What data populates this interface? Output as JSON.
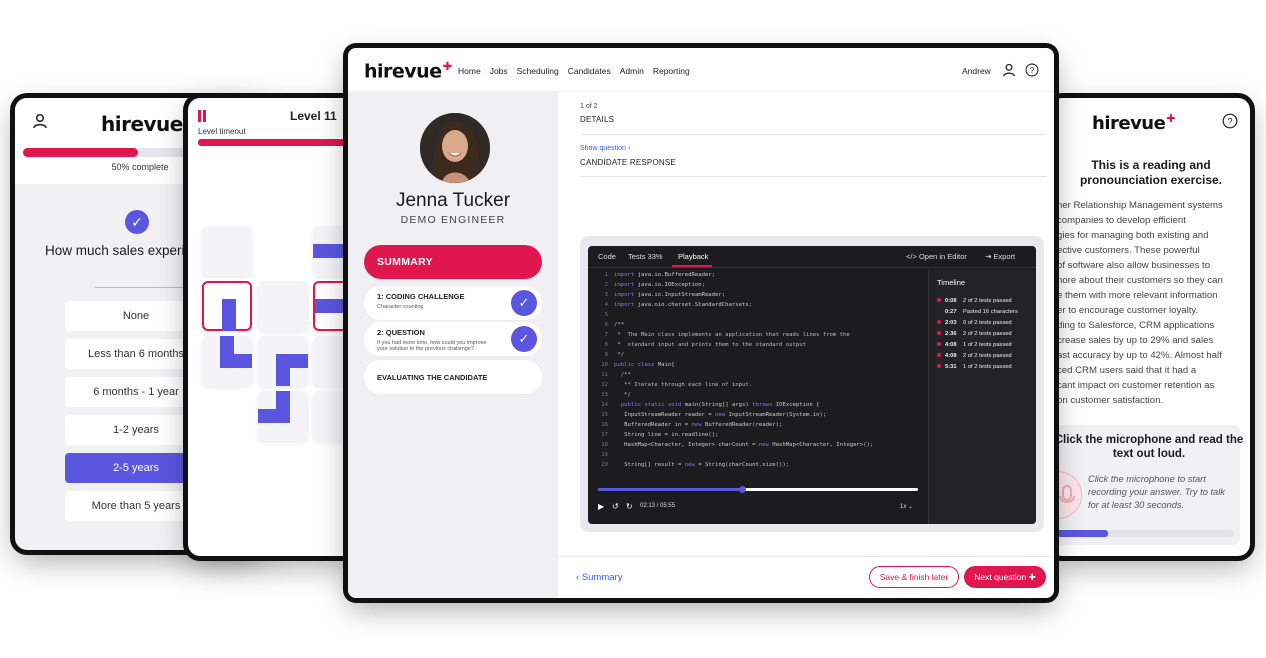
{
  "brand": {
    "logo": "hirevue",
    "accent": "#e0164f",
    "purple": "#5b56e0"
  },
  "survey_card": {
    "progress_percent": 50,
    "progress_label": "50% complete",
    "question": "How much sales experience do you have?",
    "options": [
      "None",
      "Less than 6 months",
      "6 months - 1 year",
      "1-2 years",
      "2-5 years",
      "More than 5 years"
    ],
    "selected_index": 4
  },
  "game_card": {
    "level": "Level 11",
    "timeout_label": "Level timeout"
  },
  "main": {
    "nav": {
      "links": [
        "Home",
        "Jobs",
        "Scheduling",
        "Candidates",
        "Admin",
        "Reporting"
      ],
      "user": "Andrew"
    },
    "candidate": {
      "name": "Jenna Tucker",
      "role": "DEMO ENGINEER"
    },
    "summary_label": "SUMMARY",
    "steps": [
      {
        "title": "1: CODING CHALLENGE",
        "subtitle": "Character counting",
        "done": true
      },
      {
        "title": "2: QUESTION",
        "subtitle": "If you had more time, how could you improve your solution to the previous challenge?",
        "done": true
      },
      {
        "title": "EVALUATING THE CANDIDATE",
        "subtitle": "",
        "done": false
      }
    ],
    "pager": "1 of 2",
    "details_label": "DETAILS",
    "show_question": "Show question",
    "response_label": "CANDIDATE RESPONSE",
    "code_tabs": {
      "code": "Code",
      "tests": "Tests 33%",
      "playback": "Playback",
      "open_editor": "Open in Editor",
      "export": "Export"
    },
    "code_lines": [
      "import java.io.BufferedReader;",
      "import java.io.IOException;",
      "import java.io.InputStreamReader;",
      "import java.nio.charset.StandardCharsets;",
      "",
      "/**",
      " *  The Main class implements an application that reads lines from the",
      " *  standard input and prints them to the standard output",
      " */",
      "public class Main{",
      "  /**",
      "   ** Iterate through each line of input.",
      "   */",
      "  public static void main(String[] args) throws IOException {",
      "   InputStreamReader reader = new InputStreamReader(System.in);",
      "   BufferedReader in = new BufferedReader(reader);",
      "   String line = in.readline();",
      "   HashMap<Character, Integer> charCount = new HashMap<Character, Integer>();",
      "",
      "   String[] result = new = String(charCount.size());"
    ],
    "timeline_title": "Timeline",
    "timeline": [
      {
        "time": "0:08",
        "event": "2 of 2 tests passed",
        "dot": true
      },
      {
        "time": "0:27",
        "event": "Pasted 16 characters",
        "dot": false
      },
      {
        "time": "2:03",
        "event": "0 of 2 tests passed",
        "dot": true
      },
      {
        "time": "2:36",
        "event": "2 of 2 tests passed",
        "dot": true
      },
      {
        "time": "4:08",
        "event": "1 of 2 tests passed",
        "dot": true
      },
      {
        "time": "4:08",
        "event": "2 of 2 tests passed",
        "dot": true
      },
      {
        "time": "5:31",
        "event": "1 of 2 tests passed",
        "dot": true
      }
    ],
    "player": {
      "current": "02:13",
      "total": "05:55",
      "speed": "1x",
      "progress_fraction": 0.45
    },
    "back_label": "Summary",
    "save_label": "Save & finish later",
    "next_label": "Next question"
  },
  "reading_card": {
    "heading": "This is a reading and pronounciation exercise.",
    "text_lines": [
      "ner Relationship Management systems",
      "companies to develop efficient",
      "gies for managing both existing and",
      "ective customers. These powerful",
      "of software also allow businesses to",
      "nore about their customers so they can",
      "e them with more relevant information",
      "er to encourage customer loyalty.",
      "ding to Salesforce, CRM applications",
      "crease sales by up to 29% and sales",
      "ast accuracy by up to 42%. Almost half",
      "ced CRM users said that it had a",
      "cant impact on customer retention as",
      "on customer satisfaction."
    ],
    "mic_heading": "Click the microphone and read the text out loud.",
    "mic_text": "Click the microphone to start recording your answer. Try to talk for at least 30 seconds.",
    "mic_progress_fraction": 0.3
  }
}
